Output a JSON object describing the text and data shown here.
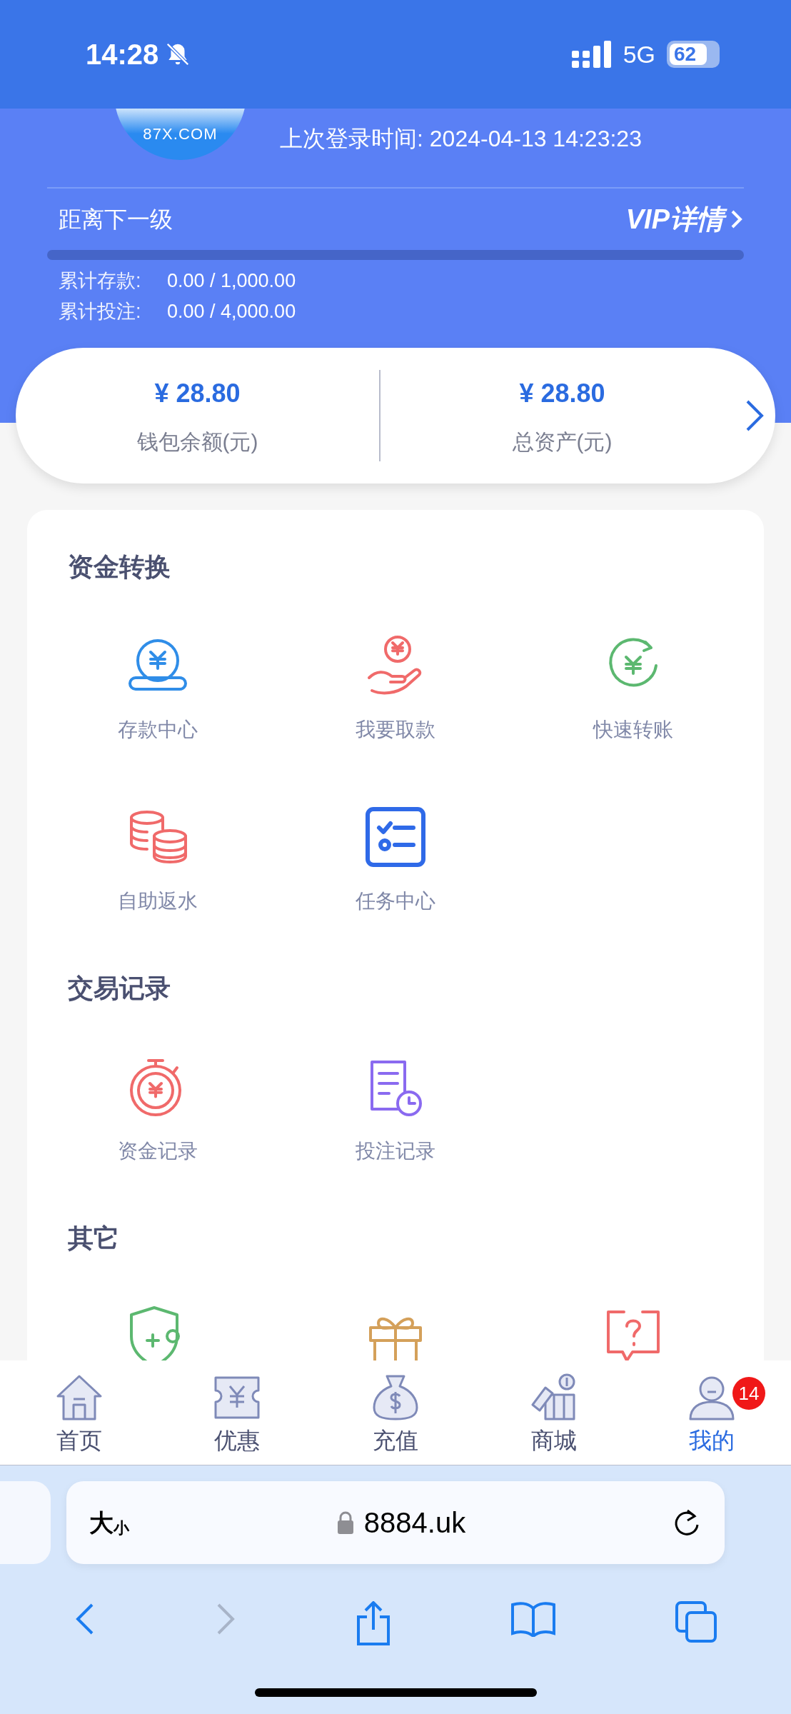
{
  "status_bar": {
    "time": "14:28",
    "network": "5G",
    "battery": "62"
  },
  "header": {
    "logo_text": "87X.COM",
    "last_login": "上次登录时间: 2024-04-13 14:23:23",
    "next_level_label": "距离下一级",
    "vip_link": "VIP详情",
    "level": 0,
    "stats": [
      {
        "label": "累计存款:",
        "value": "0.00 / 1,000.00"
      },
      {
        "label": "累计投注:",
        "value": "0.00 / 4,000.00"
      }
    ]
  },
  "balances": [
    {
      "amount": "¥ 28.80",
      "label": "钱包余额(元)"
    },
    {
      "amount": "¥ 28.80",
      "label": "总资产(元)"
    }
  ],
  "sections": [
    {
      "title": "资金转换",
      "items": [
        {
          "kind": "deposit",
          "label": "存款中心"
        },
        {
          "kind": "withdraw",
          "label": "我要取款"
        },
        {
          "kind": "transfer",
          "label": "快速转账"
        },
        {
          "kind": "rebate",
          "label": "自助返水"
        },
        {
          "kind": "task",
          "label": "任务中心"
        }
      ]
    },
    {
      "title": "交易记录",
      "items": [
        {
          "kind": "fund_record",
          "label": "资金记录"
        },
        {
          "kind": "bet_record",
          "label": "投注记录"
        }
      ]
    },
    {
      "title": "其它",
      "items": [
        {
          "kind": "security"
        },
        {
          "kind": "gift"
        },
        {
          "kind": "help"
        }
      ]
    }
  ],
  "tab_bar": [
    {
      "kind": "home",
      "label": "首页",
      "selected": false
    },
    {
      "kind": "promo",
      "label": "优惠",
      "selected": false
    },
    {
      "kind": "recharge",
      "label": "充值",
      "selected": false
    },
    {
      "kind": "mall",
      "label": "商城",
      "selected": false
    },
    {
      "kind": "profile",
      "label": "我的",
      "selected": true,
      "badge": "14"
    }
  ],
  "browser": {
    "format_large": "大",
    "format_small": "小",
    "url": "8884.uk"
  }
}
